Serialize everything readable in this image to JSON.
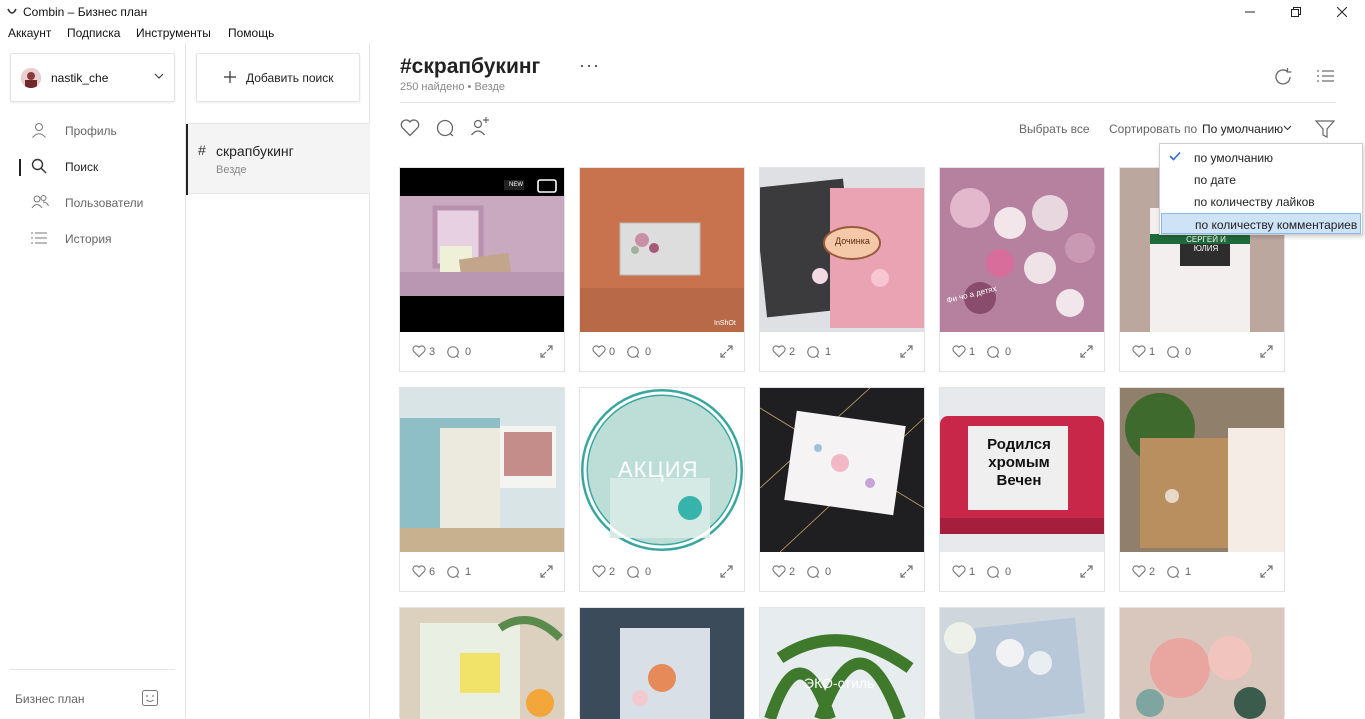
{
  "window": {
    "title": "Combin – Бизнес план"
  },
  "menu": [
    "Аккаунт",
    "Подписка",
    "Инструменты",
    "Помощь"
  ],
  "account": {
    "name": "nastik_che"
  },
  "nav": [
    {
      "label": "Профиль",
      "icon": "user-icon"
    },
    {
      "label": "Поиск",
      "icon": "search-icon"
    },
    {
      "label": "Пользователи",
      "icon": "users-icon"
    },
    {
      "label": "История",
      "icon": "history-list-icon"
    }
  ],
  "plan": {
    "label": "Бизнес план"
  },
  "searches": {
    "add_label": "Добавить поиск",
    "items": [
      {
        "hash": "#",
        "name": "скрапбукинг",
        "scope": "Везде"
      }
    ]
  },
  "main": {
    "title": "#скрапбукинг",
    "found": "250 найдено",
    "scope": "Везде",
    "select_all": "Выбрать все",
    "sort_label": "Сортировать по",
    "sort_value": "По умолчанию"
  },
  "sort_options": [
    {
      "label": "по умолчанию",
      "checked": true
    },
    {
      "label": "по дате",
      "checked": false
    },
    {
      "label": "по количеству лайков",
      "checked": false
    },
    {
      "label": "по количеству комментариев",
      "checked": false
    }
  ],
  "posts": [
    {
      "likes": "3",
      "comments": "0",
      "badge": "NEW"
    },
    {
      "likes": "0",
      "comments": "0",
      "overlay": "InShOt"
    },
    {
      "likes": "2",
      "comments": "1",
      "overlay": "Дочинка"
    },
    {
      "likes": "1",
      "comments": "0",
      "overlay": "Фи чо а детях"
    },
    {
      "likes": "1",
      "comments": "0",
      "overlay": "СЕРГЕЙ И ЮЛИЯ"
    },
    {
      "likes": "6",
      "comments": "1"
    },
    {
      "likes": "2",
      "comments": "0",
      "overlay": "АКЦИЯ"
    },
    {
      "likes": "2",
      "comments": "0"
    },
    {
      "likes": "1",
      "comments": "0",
      "overlay": "Родился хромым Вечен"
    },
    {
      "likes": "2",
      "comments": "1"
    },
    {
      "overlay": ""
    },
    {
      "overlay": ""
    },
    {
      "overlay": "ЭКО-стиль"
    },
    {
      "overlay": ""
    },
    {
      "overlay": ""
    }
  ],
  "colors": {
    "accent": "#222222",
    "dropdown_hover": "#cfe3f7",
    "muted": "#888888"
  }
}
